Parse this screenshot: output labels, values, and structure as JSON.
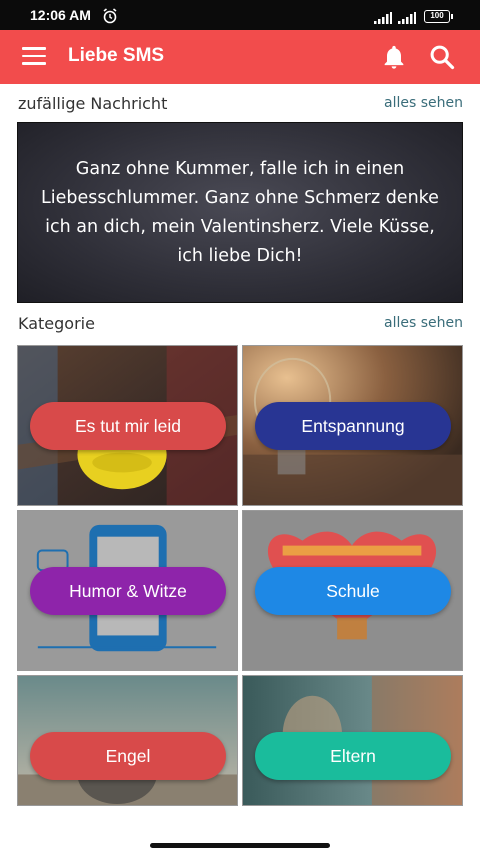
{
  "status_bar": {
    "time": "12:06 AM",
    "battery": "100"
  },
  "app_bar": {
    "title": "Liebe SMS"
  },
  "random_section": {
    "label": "zufällige Nachricht",
    "see_all": "alles sehen",
    "message": "Ganz ohne Kummer, falle ich in einen Liebesschlummer. Ganz ohne Schmerz denke ich an dich, mein Valentinsherz. Viele Küsse, ich liebe Dich!"
  },
  "category_section": {
    "label": "Kategorie",
    "see_all": "alles sehen"
  },
  "categories": [
    {
      "label": "Es tut mir leid",
      "color": "#d84a4a"
    },
    {
      "label": "Entspannung",
      "color": "#283593"
    },
    {
      "label": "Humor & Witze",
      "color": "#8e24aa"
    },
    {
      "label": "Schule",
      "color": "#1e88e5"
    },
    {
      "label": "Engel",
      "color": "#d84a4a"
    },
    {
      "label": "Eltern",
      "color": "#1abc9c"
    }
  ]
}
